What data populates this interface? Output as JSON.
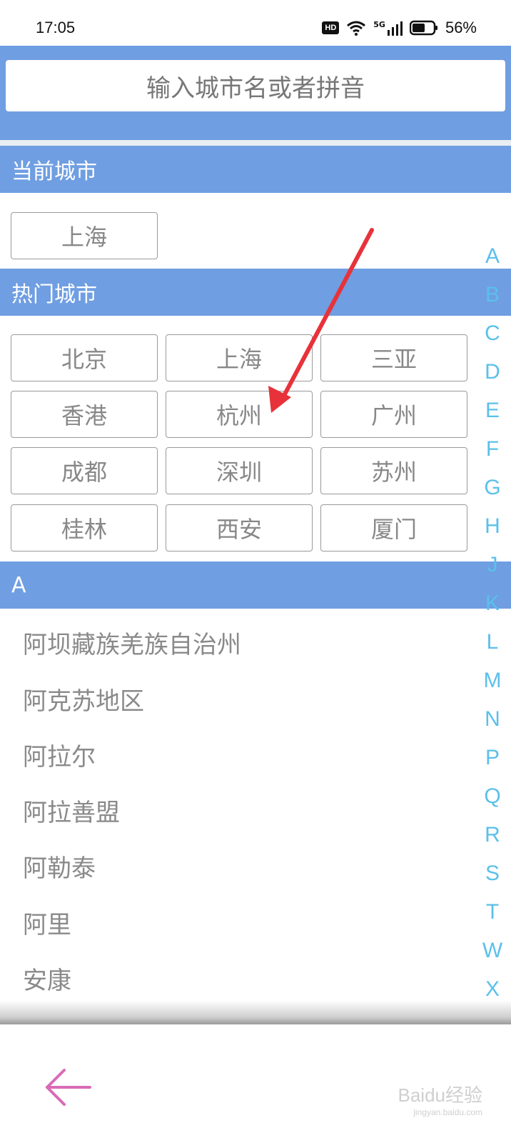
{
  "status_bar": {
    "time": "17:05",
    "hd": "HD",
    "network": "5G",
    "battery_pct": "56%",
    "icons": [
      "wifi-icon",
      "signal-icon",
      "battery-icon"
    ]
  },
  "search": {
    "placeholder": "输入城市名或者拼音"
  },
  "current_city": {
    "header": "当前城市",
    "city": "上海"
  },
  "hot_cities": {
    "header": "热门城市",
    "cities": [
      "北京",
      "上海",
      "三亚",
      "香港",
      "杭州",
      "广州",
      "成都",
      "深圳",
      "苏州",
      "桂林",
      "西安",
      "厦门"
    ]
  },
  "section_a": {
    "header": "A",
    "items": [
      "阿坝藏族羌族自治州",
      "阿克苏地区",
      "阿拉尔",
      "阿拉善盟",
      "阿勒泰",
      "阿里",
      "安康"
    ]
  },
  "index_letters": [
    "A",
    "B",
    "C",
    "D",
    "E",
    "F",
    "G",
    "H",
    "J",
    "K",
    "L",
    "M",
    "N",
    "P",
    "Q",
    "R",
    "S",
    "T",
    "W",
    "X"
  ],
  "colors": {
    "header_blue": "#6f9ee2",
    "index_letter": "#5bc0ea",
    "annotation_arrow": "#e8323a",
    "back_arrow": "#d86bb7"
  },
  "watermark": {
    "text": "Baidu经验",
    "sub": "jingyan.baidu.com"
  }
}
